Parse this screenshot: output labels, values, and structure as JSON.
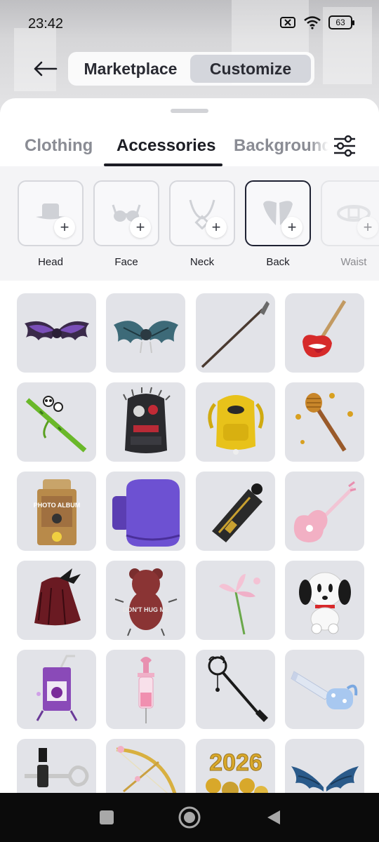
{
  "status_bar": {
    "time": "23:42",
    "battery": "63"
  },
  "header": {
    "segments": [
      {
        "label": "Marketplace",
        "selected": false
      },
      {
        "label": "Customize",
        "selected": true
      }
    ]
  },
  "tabs": [
    {
      "label": "Clothing",
      "selected": false
    },
    {
      "label": "Accessories",
      "selected": true
    },
    {
      "label": "Background",
      "selected": false
    }
  ],
  "categories": [
    {
      "label": "Head",
      "icon": "hat-icon"
    },
    {
      "label": "Face",
      "icon": "glasses-icon"
    },
    {
      "label": "Neck",
      "icon": "necklace-icon"
    },
    {
      "label": "Back",
      "icon": "wings-icon",
      "selected": true
    },
    {
      "label": "Waist",
      "icon": "belt-icon"
    }
  ],
  "items": [
    {
      "name": "purple-bat-wings",
      "icon": "bat-wings-icon"
    },
    {
      "name": "teal-dragon-wings",
      "icon": "dragon-wings-icon"
    },
    {
      "name": "spear",
      "icon": "spear-icon"
    },
    {
      "name": "tongue-guitar",
      "icon": "guitar-icon"
    },
    {
      "name": "panda-bamboo",
      "icon": "bamboo-icon"
    },
    {
      "name": "spiked-backpack",
      "icon": "backpack-icon"
    },
    {
      "name": "yellow-nyc-backpack",
      "icon": "backpack-icon"
    },
    {
      "name": "honey-dipper",
      "icon": "honey-dipper-icon"
    },
    {
      "name": "photo-album",
      "icon": "photo-album-icon",
      "text": "PHOTO ALBUM"
    },
    {
      "name": "purple-shell",
      "icon": "shell-icon"
    },
    {
      "name": "blaster",
      "icon": "blaster-icon"
    },
    {
      "name": "pink-guitar",
      "icon": "guitar-icon"
    },
    {
      "name": "red-cape",
      "icon": "cape-icon"
    },
    {
      "name": "dont-hug-me-bear",
      "icon": "bear-icon",
      "text": "DON'T HUG ME"
    },
    {
      "name": "lily-flower",
      "icon": "flower-icon"
    },
    {
      "name": "white-puppy",
      "icon": "puppy-icon"
    },
    {
      "name": "grape-juice-box",
      "icon": "juice-box-icon"
    },
    {
      "name": "pink-syringe",
      "icon": "syringe-icon"
    },
    {
      "name": "ornate-key",
      "icon": "key-icon"
    },
    {
      "name": "blue-chainsaw",
      "icon": "chainsaw-icon"
    },
    {
      "name": "silver-heart-key",
      "icon": "key-icon"
    },
    {
      "name": "golden-bow",
      "icon": "bow-icon"
    },
    {
      "name": "2026-balloons",
      "icon": "balloons-icon",
      "text": "2026"
    },
    {
      "name": "blue-angel-wings",
      "icon": "wings-icon"
    }
  ]
}
